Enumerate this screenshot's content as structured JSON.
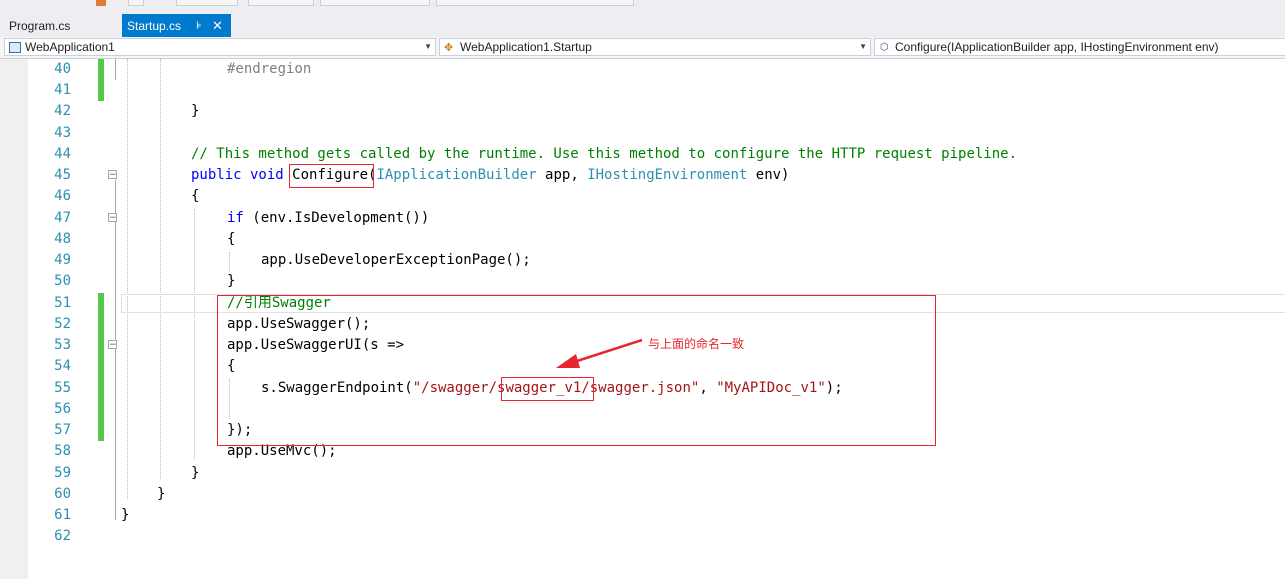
{
  "tabs": [
    {
      "label": "Program.cs",
      "active": false
    },
    {
      "label": "Startup.cs",
      "active": true
    }
  ],
  "tab_pin_glyph": "⊧",
  "tab_close_glyph": "✕",
  "navbar": {
    "project": "WebApplication1",
    "class": "WebApplication1.Startup",
    "member": "Configure(IApplicationBuilder app, IHostingEnvironment env)"
  },
  "line_numbers": [
    "40",
    "41",
    "42",
    "43",
    "44",
    "45",
    "46",
    "47",
    "48",
    "49",
    "50",
    "51",
    "52",
    "53",
    "54",
    "55",
    "56",
    "57",
    "58",
    "59",
    "60",
    "61",
    "62"
  ],
  "code": {
    "l40": "#endregion",
    "l42": "}",
    "l44": "// This method gets called by the runtime. Use this method to configure the HTTP request pipeline.",
    "l45_kw": "public void ",
    "l45_name": "Configure",
    "l45_p1": "(",
    "l45_t1": "IApplicationBuilder",
    "l45_p2": " app, ",
    "l45_t2": "IHostingEnvironment",
    "l45_p3": " env)",
    "l46": "{",
    "l47_kw": "if",
    "l47_rest": " (env.IsDevelopment())",
    "l48": "{",
    "l49": "app.UseDeveloperExceptionPage();",
    "l50": "}",
    "l51": "//引用Swagger",
    "l52": "app.UseSwagger();",
    "l53": "app.UseSwaggerUI(s =>",
    "l54": "{",
    "l55_a": "s.SwaggerEndpoint(",
    "l55_s1": "\"/swagger/",
    "l55_s2": "swagger_v1",
    "l55_s3": "/swagger.json\"",
    "l55_b": ", ",
    "l55_s4": "\"MyAPIDoc_v1\"",
    "l55_c": ");",
    "l57": "});",
    "l58": "app.UseMvc();",
    "l59": "}",
    "l60": "}",
    "l61": "}"
  },
  "annotation": "与上面的命名一致",
  "colors": {
    "accent": "#007acc",
    "keyword": "#0000ff",
    "type": "#2b91af",
    "comment": "#008000",
    "string": "#a31515",
    "annotation": "#e8262d",
    "change_marker": "#57c84c"
  }
}
